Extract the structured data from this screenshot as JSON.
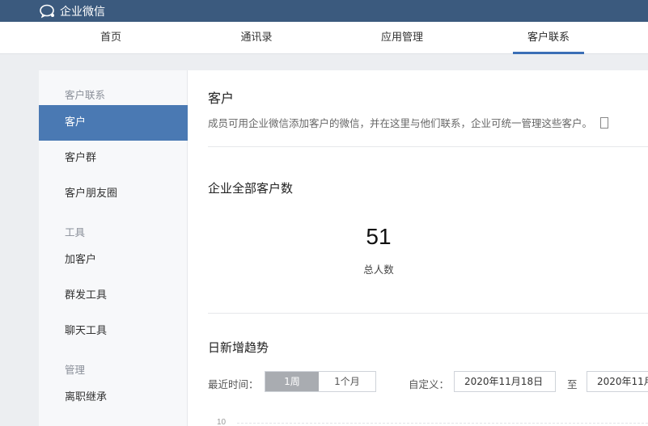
{
  "topbar": {
    "app_title": "企业微信"
  },
  "nav": {
    "items": [
      {
        "label": "首页"
      },
      {
        "label": "通讯录"
      },
      {
        "label": "应用管理"
      },
      {
        "label": "客户联系"
      }
    ],
    "active_index": 3
  },
  "sidebar": {
    "groups": [
      {
        "title": "客户联系",
        "items": [
          "客户",
          "客户群",
          "客户朋友圈"
        ]
      },
      {
        "title": "工具",
        "items": [
          "加客户",
          "群发工具",
          "聊天工具"
        ]
      },
      {
        "title": "管理",
        "items": [
          "离职继承"
        ]
      }
    ],
    "active_item": "客户"
  },
  "main": {
    "title": "客户",
    "description": "成员可用企业微信添加客户的微信，并在这里与他们联系，企业可统一管理这些客户。",
    "total_section": {
      "title": "企业全部客户数",
      "count": "51",
      "count_label": "总人数"
    },
    "trend_section": {
      "title": "日新增趋势",
      "recent_label": "最近时间：",
      "periods": [
        "1周",
        "1个月"
      ],
      "active_period": "1周",
      "custom_label": "自定义：",
      "start_date": "2020年11月18日",
      "to_label": "至",
      "end_date": "2020年11月",
      "y_tick": "10"
    }
  },
  "colors": {
    "topbar": "#3b5a7e",
    "active_sidebar": "#4a79b3",
    "nav_underline": "#3b6fb6"
  }
}
